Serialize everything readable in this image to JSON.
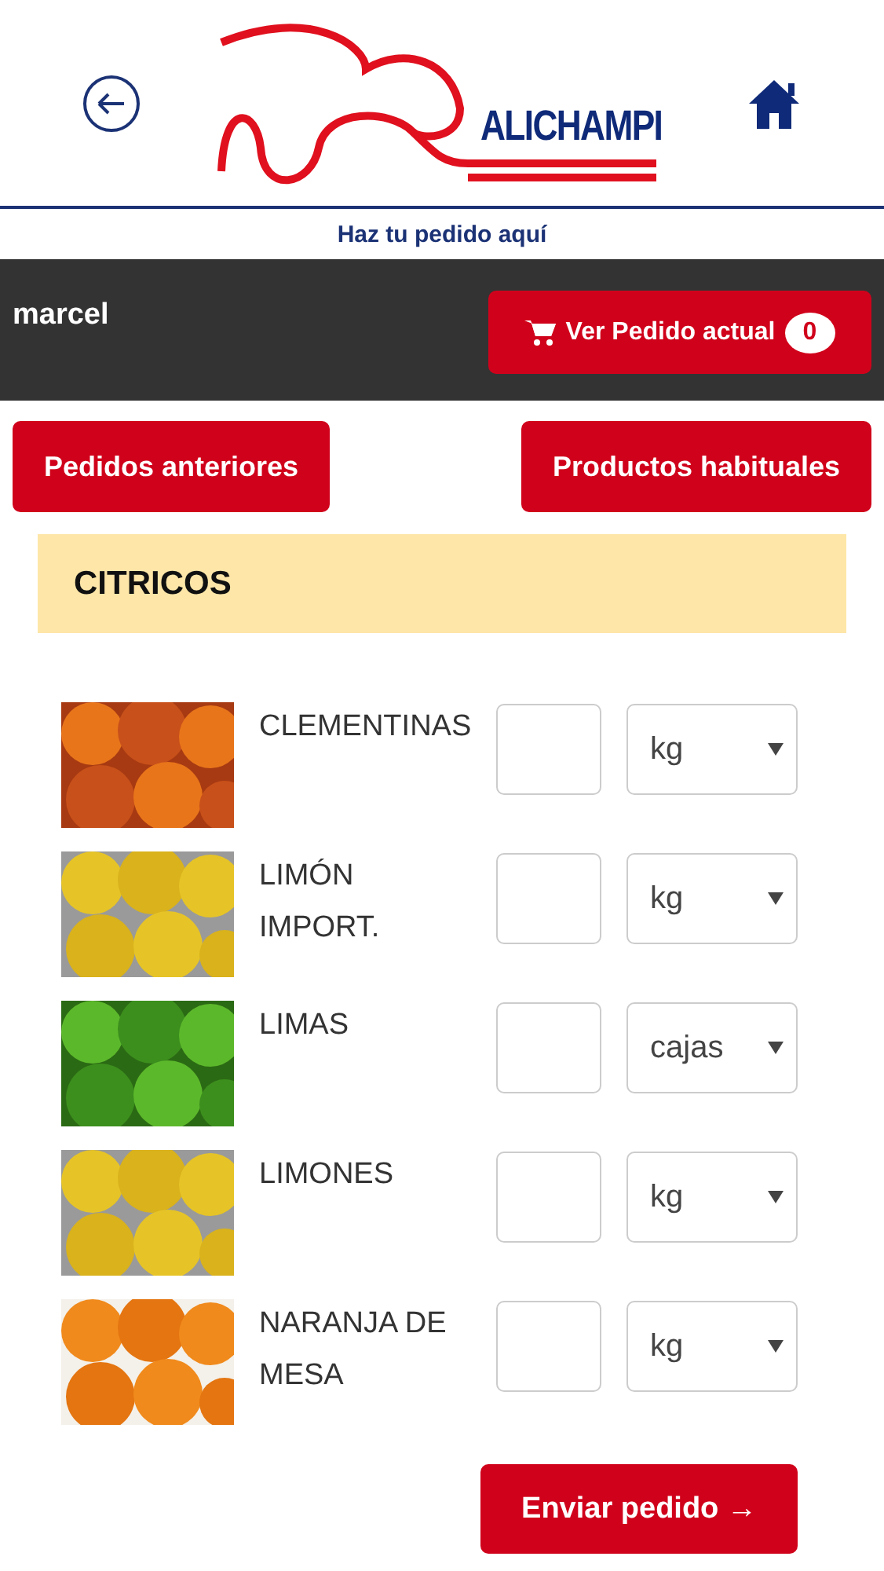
{
  "header": {
    "brand": "ALICHAMPI",
    "tagline": "Haz tu pedido aquí"
  },
  "user_bar": {
    "user": "marcel",
    "cart_button": "Ver Pedido actual",
    "cart_count": "0"
  },
  "nav_buttons": [
    "Pedidos anteriores",
    "Productos habituales"
  ],
  "category": "CITRICOS",
  "products": [
    {
      "name": "CLEMENTINAS",
      "unit": "kg"
    },
    {
      "name": "LIMÓN IMPORT.",
      "unit": "kg"
    },
    {
      "name": "LIMAS",
      "unit": "cajas"
    },
    {
      "name": "LIMONES",
      "unit": "kg"
    },
    {
      "name": "NARANJA DE MESA",
      "unit": "kg"
    }
  ],
  "submit_button": "Enviar pedido →"
}
